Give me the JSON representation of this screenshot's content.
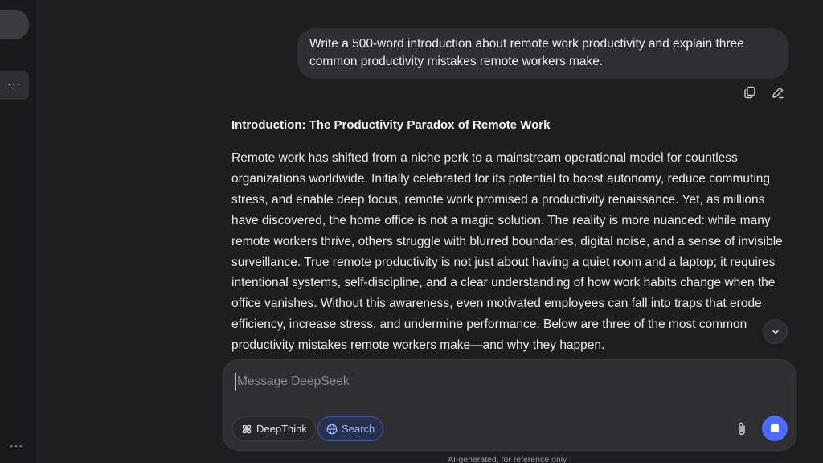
{
  "sidebar": {
    "more_label": "···",
    "footer_more_label": "···"
  },
  "conversation": {
    "user_message": "Write a 500-word introduction about remote work productivity and explain three common productivity mistakes remote workers make.",
    "message_actions": [
      {
        "icon": "copy-icon"
      },
      {
        "icon": "edit-icon"
      }
    ],
    "assistant": {
      "heading": "Introduction: The Productivity Paradox of Remote Work",
      "paragraph": "Remote work has shifted from a niche perk to a mainstream operational model for countless organizations worldwide. Initially celebrated for its potential to boost autonomy, reduce commuting stress, and enable deep focus, remote work promised a productivity renaissance. Yet, as millions have discovered, the home office is not a magic solution. The reality is more nuanced: while many remote workers thrive, others struggle with blurred boundaries, digital noise, and a sense of invisible surveillance. True remote productivity is not just about having a quiet room and a laptop; it requires intentional systems, self-discipline, and a clear understanding of how work habits change when the office vanishes. Without this awareness, even motivated employees can fall into traps that erode efficiency, increase stress, and undermine performance. Below are three of the most common productivity mistakes remote workers make—and why they happen."
    }
  },
  "composer": {
    "placeholder": "Message DeepSeek",
    "value": "",
    "deepthink_label": "DeepThink",
    "search_label": "Search",
    "search_active": true,
    "accent_color": "#4d6bfe"
  },
  "footer": {
    "disclaimer": "AI-generated, for reference only"
  }
}
